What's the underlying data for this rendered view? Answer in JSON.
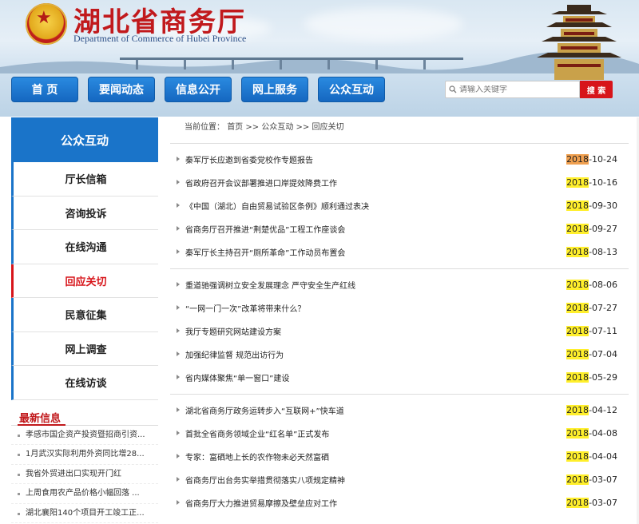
{
  "site": {
    "title": "湖北省商务厅",
    "subtitle": "Department of Commerce of Hubei Province",
    "emblem_glyph": "★"
  },
  "nav": {
    "items": [
      {
        "label": "首  页"
      },
      {
        "label": "要闻动态"
      },
      {
        "label": "信息公开"
      },
      {
        "label": "网上服务"
      },
      {
        "label": "公众互动"
      }
    ]
  },
  "search": {
    "placeholder": "请输入关键字",
    "button_label": "搜  索"
  },
  "sidebar": {
    "heading": "公众互动",
    "items": [
      {
        "label": "厅长信箱"
      },
      {
        "label": "咨询投诉"
      },
      {
        "label": "在线沟通"
      },
      {
        "label": "回应关切"
      },
      {
        "label": "民意征集"
      },
      {
        "label": "网上调查"
      },
      {
        "label": "在线访谈"
      }
    ],
    "active_index": 3,
    "latest_heading": "最新信息",
    "latest": [
      "孝感市国企资产投资暨招商引资...",
      "1月武汉实际利用外资同比增28...",
      "我省外贸进出口实现开门红",
      "上周食用农产品价格小幅回落 ...",
      "湖北襄阳140个项目开工竣工正..."
    ]
  },
  "breadcrumb": {
    "prefix": "当前位置：",
    "home": "首页",
    "sep": ">>",
    "section": "公众互动",
    "current": "回应关切"
  },
  "articles": [
    [
      {
        "title": "秦军厅长应邀到省委党校作专题报告",
        "year": "2018",
        "md": "-10-24"
      },
      {
        "title": "省政府召开会议部署推进口岸提效降费工作",
        "year": "2018",
        "md": "-10-16"
      },
      {
        "title": "《中国（湖北）自由贸易试验区条例》顺利通过表决",
        "year": "2018",
        "md": "-09-30"
      },
      {
        "title": "省商务厅召开推进“荆楚优品”工程工作座谈会",
        "year": "2018",
        "md": "-09-27"
      },
      {
        "title": "秦军厅长主持召开“厕所革命”工作动员布置会",
        "year": "2018",
        "md": "-08-13"
      }
    ],
    [
      {
        "title": "重道驰强调树立安全发展理念 严守安全生产红线",
        "year": "2018",
        "md": "-08-06"
      },
      {
        "title": "“一网一门一次”改革将带来什么？",
        "year": "2018",
        "md": "-07-27"
      },
      {
        "title": "我厅专题研究网站建设方案",
        "year": "2018",
        "md": "-07-11"
      },
      {
        "title": "加强纪律监督 规范出访行为",
        "year": "2018",
        "md": "-07-04"
      },
      {
        "title": "省内媒体聚焦“单一窗口”建设",
        "year": "2018",
        "md": "-05-29"
      }
    ],
    [
      {
        "title": "湖北省商务厅政务运转步入“互联网+”快车道",
        "year": "2018",
        "md": "-04-12"
      },
      {
        "title": "首批全省商务领域企业“红名单”正式发布",
        "year": "2018",
        "md": "-04-08"
      },
      {
        "title": "专家：富硒地上长的农作物未必天然富硒",
        "year": "2018",
        "md": "-04-04"
      },
      {
        "title": "省商务厅出台务实举措贯彻落实八项规定精神",
        "year": "2018",
        "md": "-03-07"
      },
      {
        "title": "省商务厅大力推进贸易摩擦及壁垒应对工作",
        "year": "2018",
        "md": "-03-07"
      }
    ]
  ],
  "colors": {
    "brand_red": "#c1191c",
    "nav_blue": "#1a74c9",
    "highlight_yellow": "#ffef2b",
    "highlight_orange": "#f0a050"
  }
}
